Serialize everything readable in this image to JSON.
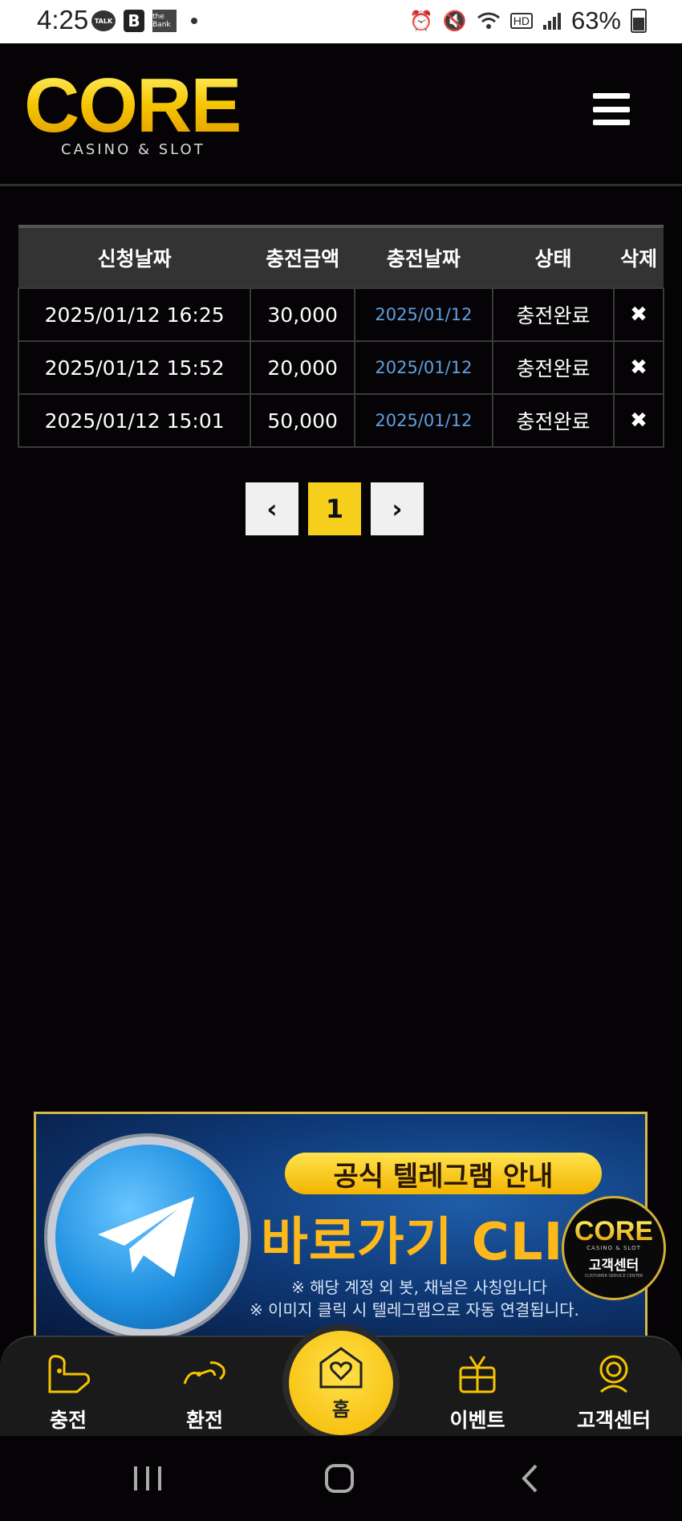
{
  "status_bar": {
    "time": "4:25",
    "talk_label": "TALK",
    "b_label": "B",
    "bank_label": "the Bank",
    "battery": "63%"
  },
  "header": {
    "logo": "CORE",
    "logo_sub": "CASINO & SLOT"
  },
  "table": {
    "headers": [
      "신청날짜",
      "충전금액",
      "충전날짜",
      "상태",
      "삭제"
    ],
    "rows": [
      {
        "applied": "2025/01/12 16:25",
        "amount": "30,000",
        "charged": "2025/01/12",
        "status": "충전완료",
        "delete": "✖"
      },
      {
        "applied": "2025/01/12 15:52",
        "amount": "20,000",
        "charged": "2025/01/12",
        "status": "충전완료",
        "delete": "✖"
      },
      {
        "applied": "2025/01/12 15:01",
        "amount": "50,000",
        "charged": "2025/01/12",
        "status": "충전완료",
        "delete": "✖"
      }
    ]
  },
  "pagination": {
    "prev": "‹",
    "current": "1",
    "next": "›"
  },
  "banner": {
    "pill": "공식 텔레그램 안내",
    "big": "바로가기 CLIC",
    "note1": "※ 해당 계정 외 봇, 채널은 사칭입니다",
    "note2": "※ 이미지 클릭 시 텔레그램으로 자동 연결됩니다."
  },
  "cs_float": {
    "logo": "CORE",
    "sub": "CASINO & SLOT",
    "label": "고객센터",
    "small": "CUSTOMER SERVICE CENTER"
  },
  "bottom_nav": {
    "charge": "충전",
    "exchange": "환전",
    "home": "홈",
    "event": "이벤트",
    "support": "고객센터"
  },
  "icons": {
    "menu": "hamburger-icon",
    "prev": "chevron-left-icon",
    "next": "chevron-right-icon",
    "telegram": "telegram-icon"
  },
  "colors": {
    "accent": "#f5cf1c",
    "date_link": "#5fa0e0",
    "background": "#050305"
  }
}
